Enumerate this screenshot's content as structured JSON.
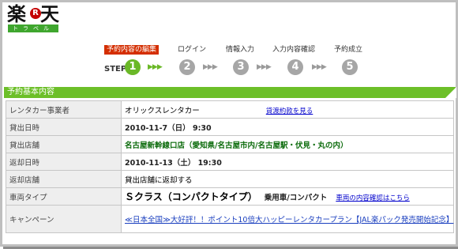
{
  "logo": {
    "kanji1": "楽",
    "r_mark": "R",
    "kanji2": "天",
    "travel": "トラベル"
  },
  "steps": {
    "step_word": "STEP",
    "items": [
      {
        "label": "予約内容の編集",
        "number": "1",
        "active": true
      },
      {
        "label": "ログイン",
        "number": "2",
        "active": false
      },
      {
        "label": "情報入力",
        "number": "3",
        "active": false
      },
      {
        "label": "入力内容確認",
        "number": "4",
        "active": false
      },
      {
        "label": "予約成立",
        "number": "5",
        "active": false
      }
    ],
    "arrow": "▶▶▶"
  },
  "section_title": "予約基本内容",
  "rows": {
    "company": {
      "label": "レンタカー事業者",
      "value": "オリックスレンタカー",
      "link": "貸渡約款を見る"
    },
    "pickup_date": {
      "label": "貸出日時",
      "value": "2010-11-7（日） 9:30"
    },
    "pickup_store": {
      "label": "貸出店舗",
      "value": "名古屋新幹線口店（愛知県/名古屋市内/名古屋駅・伏見・丸の内）"
    },
    "return_date": {
      "label": "返却日時",
      "value": "2010-11-13（土） 19:30"
    },
    "return_store": {
      "label": "返却店舗",
      "value": "貸出店舗に返却する"
    },
    "car_type": {
      "label": "車両タイプ",
      "value": "Ｓクラス（コンパクトタイプ）",
      "sub": "乗用車/コンパクト",
      "link": "車両の内容確認はこちら"
    },
    "campaign": {
      "label": "キャンペーン",
      "value": "≪日本全国≫大好評！！ポイント10倍大ハッピーレンタカープラン【JAL楽パック発売開始記念】"
    }
  }
}
